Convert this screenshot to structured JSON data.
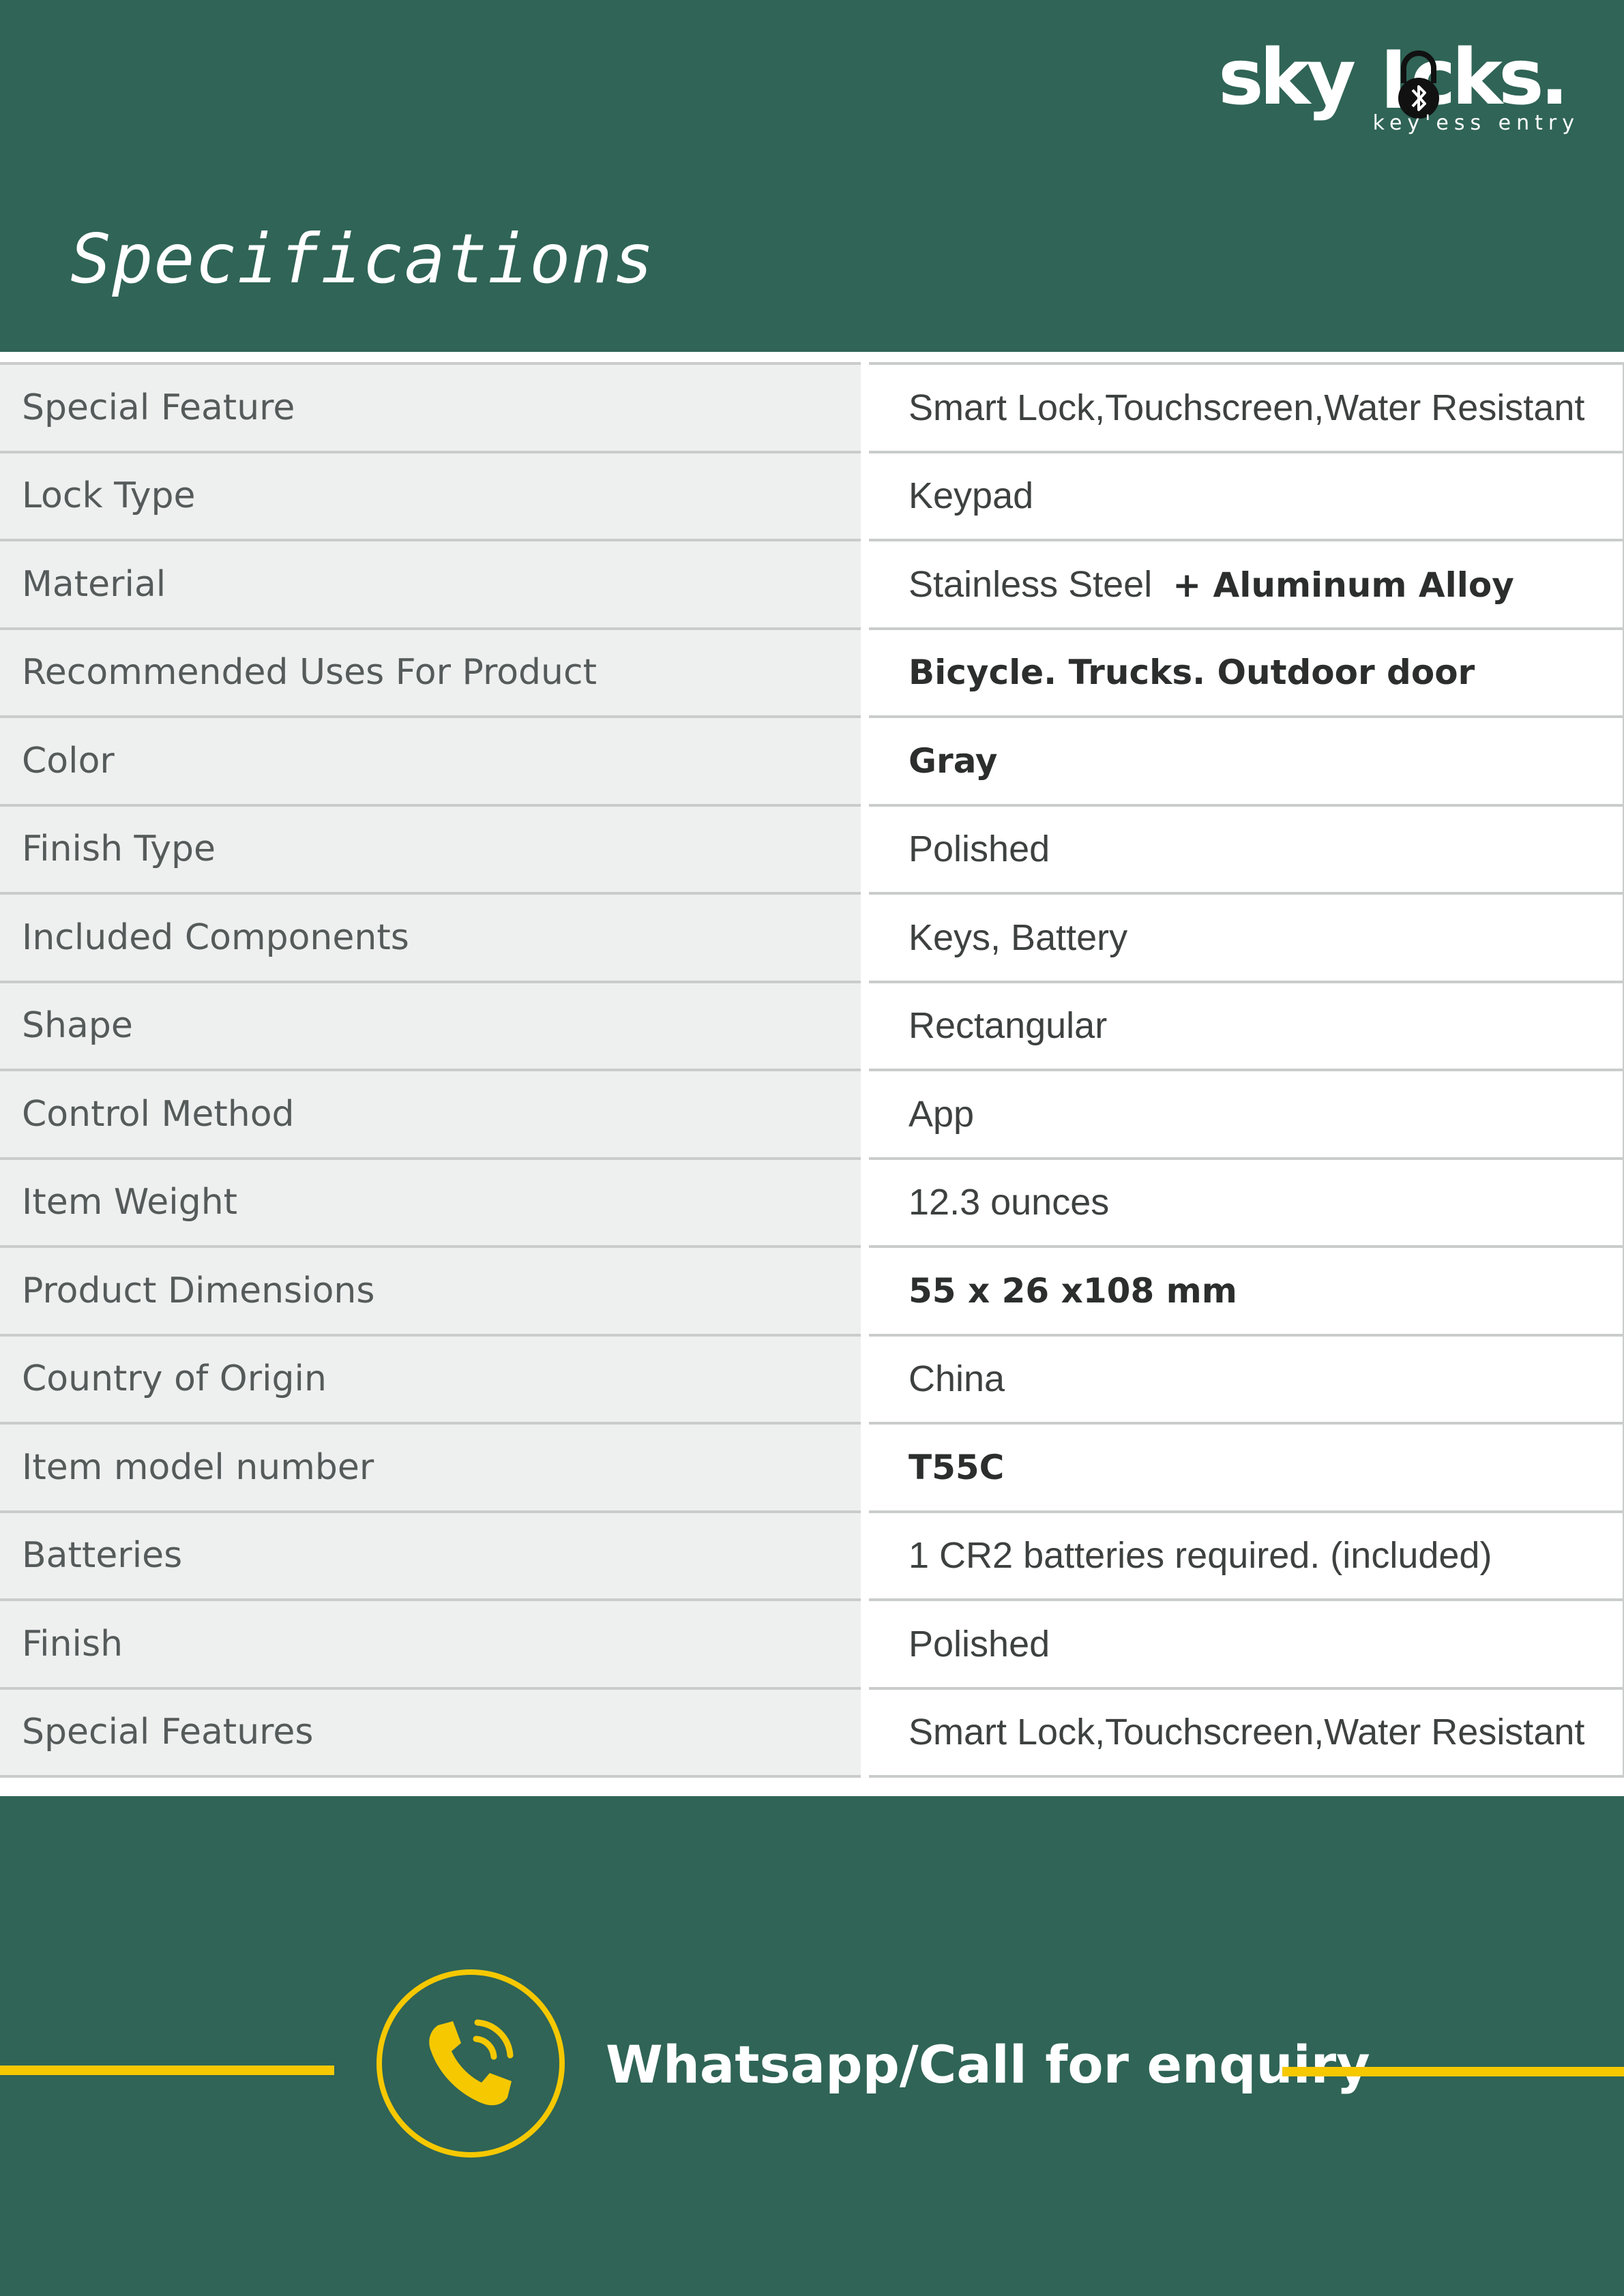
{
  "brand": {
    "logo_text": "skylocks.",
    "tagline": "key'ess entry"
  },
  "header": {
    "title": "Specifications"
  },
  "specs": [
    {
      "label": "Special Feature",
      "value": "Smart Lock,Touchscreen,Water Resistant"
    },
    {
      "label": "Lock Type",
      "value": "Keypad"
    },
    {
      "label": "Material",
      "value": "Stainless Steel",
      "value_extra": "+ Aluminum Alloy"
    },
    {
      "label": "Recommended Uses For Product",
      "value": "Bicycle. Trucks. Outdoor door"
    },
    {
      "label": "Color",
      "value": "Gray"
    },
    {
      "label": "Finish Type",
      "value": "Polished"
    },
    {
      "label": "Included Components",
      "value": "Keys, Battery"
    },
    {
      "label": "Shape",
      "value": "Rectangular"
    },
    {
      "label": "Control Method",
      "value": "App"
    },
    {
      "label": "Item Weight",
      "value": "12.3 ounces"
    },
    {
      "label": "Product Dimensions",
      "value": "55 x 26 x108 mm"
    },
    {
      "label": "Country of Origin",
      "value": "China"
    },
    {
      "label": "Item model number",
      "value": "T55C"
    },
    {
      "label": "Batteries",
      "value": "1 CR2 batteries required. (included)"
    },
    {
      "label": "Finish",
      "value": "Polished"
    },
    {
      "label": "Special Features",
      "value": "Smart Lock,Touchscreen,Water Resistant"
    }
  ],
  "footer": {
    "cta_text": "Whatsapp/Call for enquiry",
    "icon": "phone-call-icon"
  },
  "colors": {
    "background": "#2f6456",
    "accent": "#f6c800",
    "table_key_bg": "#eef0ef",
    "text_light": "#ffffff"
  }
}
